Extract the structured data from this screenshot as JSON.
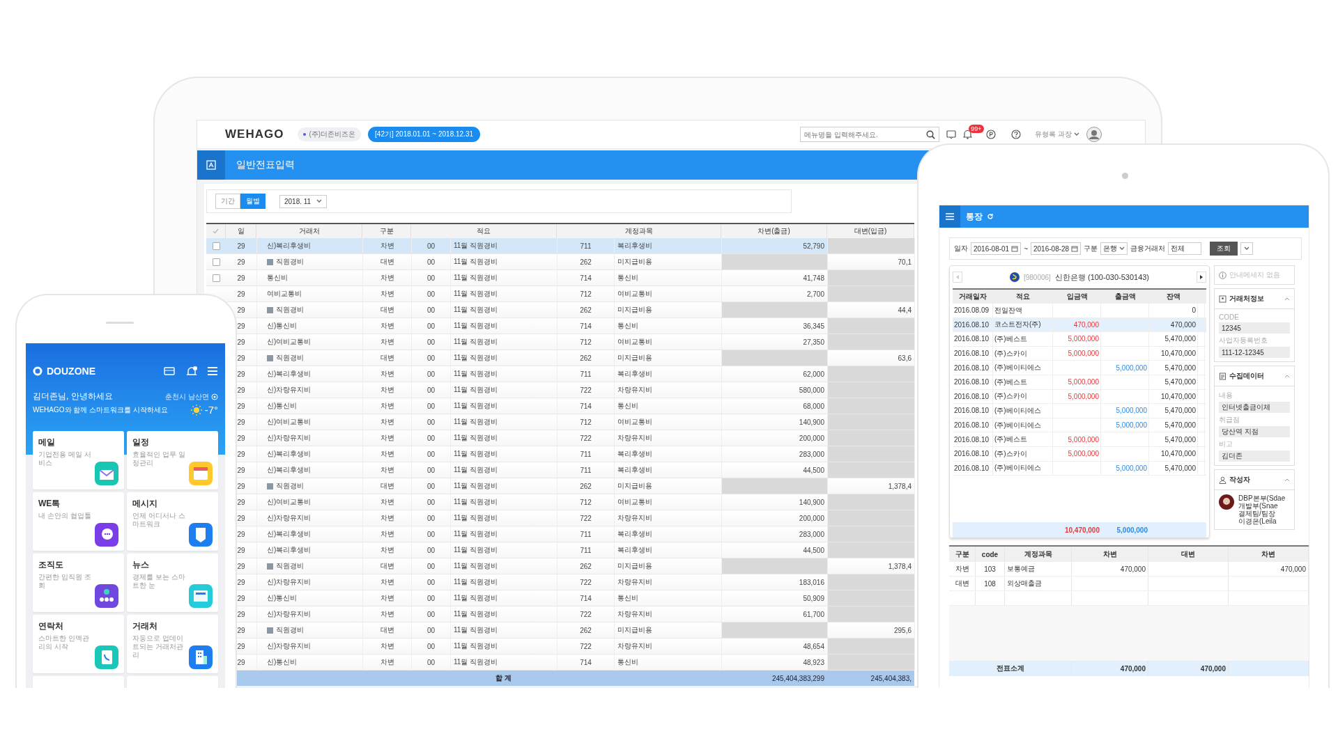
{
  "laptop": {
    "logo": "WEHAGO",
    "company": "(주)더존비즈온",
    "period": "[42기] 2018.01.01 ~ 2018.12.31",
    "search": {
      "placeholder": "메뉴명을 입력해주세요."
    },
    "notification_badge": "99+",
    "user": "유형록 과장",
    "page_title": "일반전표입력",
    "period_tabs": [
      {
        "label": "기간",
        "selected": false
      },
      {
        "label": "월별",
        "selected": true
      }
    ],
    "month_select": "2018. 11",
    "table": {
      "columns": [
        "일",
        "거래처",
        "구분",
        "적요",
        "계정과목",
        "차변(출금)",
        "대변(입금)"
      ],
      "rows": [
        {
          "kind": "line",
          "day": "29",
          "vendor": "신)복리후생비",
          "type": "차변",
          "code": "00",
          "memo": "11월 직원경비",
          "account_code": "711",
          "account": "복리후생비",
          "amount": "52,790",
          "selected": true,
          "checked": false
        },
        {
          "kind": "group",
          "day": "29",
          "vendor": "직원경비",
          "type": "대변",
          "code": "00",
          "memo": "11월 직원경비",
          "account_code": "262",
          "account": "미지급비용",
          "amount": "70,1",
          "selected": false,
          "checked": false
        },
        {
          "kind": "line",
          "day": "29",
          "vendor": "통신비",
          "type": "차변",
          "code": "00",
          "memo": "11월 직원경비",
          "account_code": "714",
          "account": "통신비",
          "amount": "41,748",
          "selected": false,
          "checked": false
        },
        {
          "kind": "line",
          "day": "29",
          "vendor": "여비교통비",
          "type": "차변",
          "code": "00",
          "memo": "11월 직원경비",
          "account_code": "712",
          "account": "여비교통비",
          "amount": "2,700",
          "selected": false
        },
        {
          "kind": "group",
          "day": "29",
          "vendor": "직원경비",
          "type": "대변",
          "code": "00",
          "memo": "11월 직원경비",
          "account_code": "262",
          "account": "미지급비용",
          "amount": "44,4",
          "selected": false
        },
        {
          "kind": "line",
          "day": "29",
          "vendor": "신)통신비",
          "type": "차변",
          "code": "00",
          "memo": "11월 직원경비",
          "account_code": "714",
          "account": "통신비",
          "amount": "36,345",
          "selected": false
        },
        {
          "kind": "line",
          "day": "29",
          "vendor": "신)여비교통비",
          "type": "차변",
          "code": "00",
          "memo": "11월 직원경비",
          "account_code": "712",
          "account": "여비교통비",
          "amount": "27,350",
          "selected": false
        },
        {
          "kind": "group",
          "day": "29",
          "vendor": "직원경비",
          "type": "대변",
          "code": "00",
          "memo": "11월 직원경비",
          "account_code": "262",
          "account": "미지급비용",
          "amount": "63,6",
          "selected": false
        },
        {
          "kind": "line",
          "day": "29",
          "vendor": "신)복리후생비",
          "type": "차변",
          "code": "00",
          "memo": "11월 직원경비",
          "account_code": "711",
          "account": "복리후생비",
          "amount": "62,000",
          "selected": false
        },
        {
          "kind": "line",
          "day": "29",
          "vendor": "신)차량유지비",
          "type": "차변",
          "code": "00",
          "memo": "11월 직원경비",
          "account_code": "722",
          "account": "차량유지비",
          "amount": "580,000",
          "selected": false
        },
        {
          "kind": "line",
          "day": "29",
          "vendor": "신)통신비",
          "type": "차변",
          "code": "00",
          "memo": "11월 직원경비",
          "account_code": "714",
          "account": "통신비",
          "amount": "68,000",
          "selected": false
        },
        {
          "kind": "line",
          "day": "29",
          "vendor": "신)여비교통비",
          "type": "차변",
          "code": "00",
          "memo": "11월 직원경비",
          "account_code": "712",
          "account": "여비교통비",
          "amount": "140,900",
          "selected": false
        },
        {
          "kind": "line",
          "day": "29",
          "vendor": "신)차량유지비",
          "type": "차변",
          "code": "00",
          "memo": "11월 직원경비",
          "account_code": "722",
          "account": "차량유지비",
          "amount": "200,000",
          "selected": false
        },
        {
          "kind": "line",
          "day": "29",
          "vendor": "신)복리후생비",
          "type": "차변",
          "code": "00",
          "memo": "11월 직원경비",
          "account_code": "711",
          "account": "복리후생비",
          "amount": "283,000",
          "selected": false
        },
        {
          "kind": "line",
          "day": "29",
          "vendor": "신)복리후생비",
          "type": "차변",
          "code": "00",
          "memo": "11월 직원경비",
          "account_code": "711",
          "account": "복리후생비",
          "amount": "44,500",
          "selected": false
        },
        {
          "kind": "group",
          "day": "29",
          "vendor": "직원경비",
          "type": "대변",
          "code": "00",
          "memo": "11월 직원경비",
          "account_code": "262",
          "account": "미지급비용",
          "amount": "1,378,4",
          "selected": false
        },
        {
          "kind": "line",
          "day": "29",
          "vendor": "신)여비교통비",
          "type": "차변",
          "code": "00",
          "memo": "11월 직원경비",
          "account_code": "712",
          "account": "여비교통비",
          "amount": "140,900",
          "selected": false
        },
        {
          "kind": "line",
          "day": "29",
          "vendor": "신)차량유지비",
          "type": "차변",
          "code": "00",
          "memo": "11월 직원경비",
          "account_code": "722",
          "account": "차량유지비",
          "amount": "200,000",
          "selected": false
        },
        {
          "kind": "line",
          "day": "29",
          "vendor": "신)복리후생비",
          "type": "차변",
          "code": "00",
          "memo": "11월 직원경비",
          "account_code": "711",
          "account": "복리후생비",
          "amount": "283,000",
          "selected": false
        },
        {
          "kind": "line",
          "day": "29",
          "vendor": "신)복리후생비",
          "type": "차변",
          "code": "00",
          "memo": "11월 직원경비",
          "account_code": "711",
          "account": "복리후생비",
          "amount": "44,500",
          "selected": false
        },
        {
          "kind": "group",
          "day": "29",
          "vendor": "직원경비",
          "type": "대변",
          "code": "00",
          "memo": "11월 직원경비",
          "account_code": "262",
          "account": "미지급비용",
          "amount": "1,378,4",
          "selected": false
        },
        {
          "kind": "line",
          "day": "29",
          "vendor": "신)차량유지비",
          "type": "차변",
          "code": "00",
          "memo": "11월 직원경비",
          "account_code": "722",
          "account": "차량유지비",
          "amount": "183,016",
          "selected": false
        },
        {
          "kind": "line",
          "day": "29",
          "vendor": "신)통신비",
          "type": "차변",
          "code": "00",
          "memo": "11월 직원경비",
          "account_code": "714",
          "account": "통신비",
          "amount": "50,909",
          "selected": false
        },
        {
          "kind": "line",
          "day": "29",
          "vendor": "신)차량유지비",
          "type": "차변",
          "code": "00",
          "memo": "11월 직원경비",
          "account_code": "722",
          "account": "차량유지비",
          "amount": "61,700",
          "selected": false
        },
        {
          "kind": "group",
          "day": "29",
          "vendor": "직원경비",
          "type": "대변",
          "code": "00",
          "memo": "11월 직원경비",
          "account_code": "262",
          "account": "미지급비용",
          "amount": "295,6",
          "selected": false
        },
        {
          "kind": "line",
          "day": "29",
          "vendor": "신)차량유지비",
          "type": "차변",
          "code": "00",
          "memo": "11월 직원경비",
          "account_code": "722",
          "account": "차량유지비",
          "amount": "48,654",
          "selected": false
        },
        {
          "kind": "line",
          "day": "29",
          "vendor": "신)통신비",
          "type": "차변",
          "code": "00",
          "memo": "11월 직원경비",
          "account_code": "714",
          "account": "통신비",
          "amount": "48,923",
          "selected": false
        }
      ],
      "total": {
        "label": "합 계",
        "debit": "245,404,383,299",
        "credit": "245,404,383,"
      }
    }
  },
  "phone": {
    "brand": "DOUZONE",
    "greeting": "김더존님, 안녕하세요",
    "subtitle": "WEHAGO와 함께 스마트워크를 시작하세요",
    "location": "춘천시 남산면",
    "temperature": "-7°",
    "apps": [
      {
        "kind": "mail",
        "title": "메일",
        "description": "기업전용 메일 서비스"
      },
      {
        "kind": "calendar",
        "title": "일정",
        "description": "효율적인 업무 일정관리"
      },
      {
        "kind": "chat",
        "title": "WE톡",
        "description": "내 손안의 협업툴"
      },
      {
        "kind": "message",
        "title": "메시지",
        "description": "언제 어디서나 스마트워크"
      },
      {
        "kind": "org",
        "title": "조직도",
        "description": "간편한 임직원 조회"
      },
      {
        "kind": "news",
        "title": "뉴스",
        "description": "경제를 보는 스마트한 눈"
      },
      {
        "kind": "contact",
        "title": "연락처",
        "description": "스마트한 인맥관리의 시작"
      },
      {
        "kind": "building",
        "title": "거래처",
        "description": "자동으로 업데이트되는 거래처관리"
      }
    ]
  },
  "tablet": {
    "title": "통장",
    "filter": {
      "date_label": "일자",
      "date_from": "2016-08-01",
      "range_sep": "~",
      "date_to": "2016-08-28",
      "type_label": "구분",
      "type_value": "은행",
      "partner_label": "금융거래처",
      "partner_value": "전체",
      "search_button": "조회"
    },
    "account_code": "[980006]",
    "account_name": "신한은행 (100-030-530143)",
    "columns": [
      "거래일자",
      "적요",
      "입금액",
      "출금액",
      "잔액"
    ],
    "rows": [
      {
        "date": "2016.08.09",
        "memo": "전일잔액",
        "deposit": "",
        "withdrawal": "",
        "balance": "0",
        "selected": false
      },
      {
        "date": "2016.08.10",
        "memo": "코스트전자(주)",
        "deposit": "470,000",
        "withdrawal": "",
        "balance": "470,000",
        "selected": true
      },
      {
        "date": "2016.08.10",
        "memo": "(주)베스트",
        "deposit": "5,000,000",
        "withdrawal": "",
        "balance": "5,470,000",
        "selected": false
      },
      {
        "date": "2016.08.10",
        "memo": "(주)스카이",
        "deposit": "5,000,000",
        "withdrawal": "",
        "balance": "10,470,000",
        "selected": false
      },
      {
        "date": "2016.08.10",
        "memo": "(주)베이티에스",
        "deposit": "",
        "withdrawal": "5,000,000",
        "balance": "5,470,000",
        "selected": false
      },
      {
        "date": "2016.08.10",
        "memo": "(주)베스트",
        "deposit": "5,000,000",
        "withdrawal": "",
        "balance": "5,470,000",
        "selected": false
      },
      {
        "date": "2016.08.10",
        "memo": "(주)스카이",
        "deposit": "5,000,000",
        "withdrawal": "",
        "balance": "10,470,000",
        "selected": false
      },
      {
        "date": "2016.08.10",
        "memo": "(주)베이티에스",
        "deposit": "",
        "withdrawal": "5,000,000",
        "balance": "5,470,000",
        "selected": false
      },
      {
        "date": "2016.08.10",
        "memo": "(주)베이티에스",
        "deposit": "",
        "withdrawal": "5,000,000",
        "balance": "5,470,000",
        "selected": false
      },
      {
        "date": "2016.08.10",
        "memo": "(주)베스트",
        "deposit": "5,000,000",
        "withdrawal": "",
        "balance": "5,470,000",
        "selected": false
      },
      {
        "date": "2016.08.10",
        "memo": "(주)스카이",
        "deposit": "5,000,000",
        "withdrawal": "",
        "balance": "10,470,000",
        "selected": false
      },
      {
        "date": "2016.08.10",
        "memo": "(주)베이티에스",
        "deposit": "",
        "withdrawal": "5,000,000",
        "balance": "5,470,000",
        "selected": false
      }
    ],
    "totals": {
      "deposit": "10,470,000",
      "withdrawal": "5,000,000"
    },
    "info_message": "안내메세지 없음",
    "panels": [
      {
        "kind": "partner",
        "title": "거래처정보",
        "fields": [
          {
            "label": "CODE",
            "value": "12345"
          },
          {
            "label": "사업자등록번호",
            "value": "111-12-12345"
          }
        ]
      },
      {
        "kind": "data",
        "title": "수집데이터",
        "fields": [
          {
            "label": "내용",
            "value": "인터넷출금이체"
          },
          {
            "label": "취급점",
            "value": "당산역 지점"
          },
          {
            "label": "비고",
            "value": "김더존"
          }
        ]
      },
      {
        "kind": "writer",
        "title": "작성자",
        "lines": [
          "DBP본부(Sdae",
          "개발부(Snae",
          "결제팀/팀장",
          "이경은(Leila"
        ]
      }
    ],
    "voucher": {
      "columns": [
        "구분",
        "code",
        "계정과목",
        "차변",
        "대변",
        "차변"
      ],
      "rows": [
        {
          "type": "차변",
          "code": "103",
          "account": "보통예금",
          "debit": "470,000",
          "credit": "",
          "debit2": "470,000"
        },
        {
          "type": "대변",
          "code": "108",
          "account": "외상매출금",
          "debit": "",
          "credit": "",
          "debit2": ""
        }
      ],
      "subtotal": {
        "label": "전표소계",
        "debit": "470,000",
        "credit": "470,000"
      }
    }
  }
}
